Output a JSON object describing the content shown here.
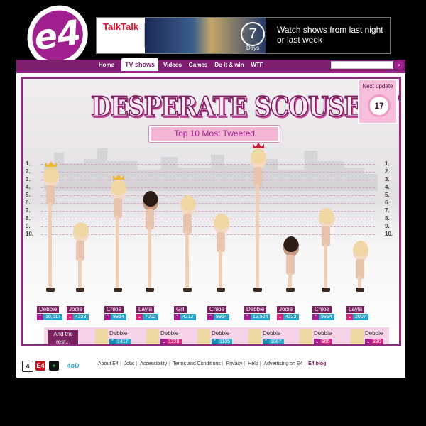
{
  "logo": {
    "text": "4"
  },
  "ad": {
    "brand": "TalkTalk",
    "badge_number": "7",
    "badge_label": "Days",
    "tagline": "Watch shows from last night or last week"
  },
  "nav": {
    "items": [
      "Home",
      "TV shows",
      "Videos",
      "Games",
      "Do it & win",
      "WTF"
    ],
    "active": "TV shows",
    "search_placeholder": ""
  },
  "feature": {
    "title": "DESPERATE SCOUSEWIVES",
    "subtitle": "Top 10 Most Tweeted",
    "next_update_label": "Next update",
    "next_update_value": "17",
    "ranks": [
      "1.",
      "2.",
      "3.",
      "4.",
      "5.",
      "6.",
      "7.",
      "8.",
      "9.",
      "10."
    ],
    "characters": [
      {
        "name": "Debbie",
        "count": "10,017",
        "trend": "up"
      },
      {
        "name": "Jodie",
        "count": "4323",
        "trend": "down"
      },
      {
        "name": "Chloe",
        "count": "9954",
        "trend": "up"
      },
      {
        "name": "Layla",
        "count": "7002",
        "trend": "down"
      },
      {
        "name": "Gill",
        "count": "4212",
        "trend": "up"
      },
      {
        "name": "Chloe",
        "count": "9954",
        "trend": "up"
      },
      {
        "name": "Debbie",
        "count": "12,924",
        "trend": "up"
      },
      {
        "name": "Jodie",
        "count": "4323",
        "trend": "down"
      },
      {
        "name": "Chloe",
        "count": "9954",
        "trend": "up"
      },
      {
        "name": "Layla",
        "count": "2007",
        "trend": "down"
      }
    ],
    "rest_label": "And the rest...",
    "rest": [
      {
        "name": "Debbie",
        "count": "1417",
        "trend": "up"
      },
      {
        "name": "Debbie",
        "count": "1228",
        "trend": "down"
      },
      {
        "name": "Debbie",
        "count": "1105",
        "trend": "up"
      },
      {
        "name": "Debbie",
        "count": "1097",
        "trend": "up"
      },
      {
        "name": "Debbie",
        "count": "965",
        "trend": "down"
      },
      {
        "name": "Debbie",
        "count": "330",
        "trend": "down"
      }
    ]
  },
  "footer": {
    "channel_icons": [
      "4",
      "E4",
      "+",
      "4oD"
    ],
    "links": [
      "About E4",
      "Jobs",
      "Accessibility",
      "Terms and Conditions",
      "Privacy",
      "Help",
      "Advertising on E4"
    ],
    "blog": "E4 blog"
  },
  "colors": {
    "brand": "#a1208f",
    "nav": "#7d1f6e",
    "count": "#2aa5c8",
    "down": "#d0277f"
  }
}
